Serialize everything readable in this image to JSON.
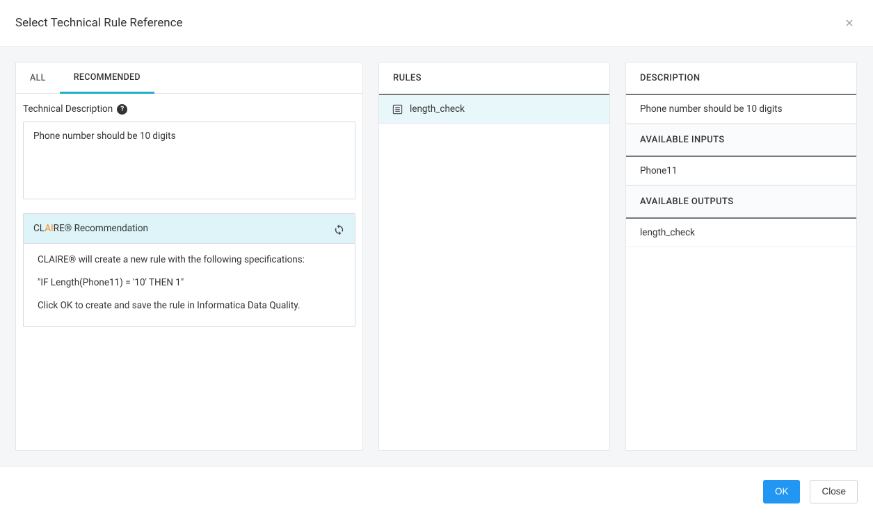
{
  "header": {
    "title": "Select Technical Rule Reference"
  },
  "left": {
    "tabs": {
      "all": "ALL",
      "recommended": "RECOMMENDED"
    },
    "tech_desc_label": "Technical Description",
    "tech_desc_value": "Phone number should be 10 digits",
    "claire": {
      "title_pre": "CL",
      "title_ai": "AI",
      "title_post": "RE® Recommendation",
      "line1": "CLAIRE® will create a new rule with the following specifications:",
      "line2": "\"IF Length(Phone11) = '10' THEN 1\"",
      "line3": "Click OK to create and save the rule in Informatica Data Quality."
    }
  },
  "middle": {
    "header": "RULES",
    "selected_rule": "length_check"
  },
  "right": {
    "description_header": "DESCRIPTION",
    "description_value": "Phone number should be 10 digits",
    "inputs_header": "AVAILABLE INPUTS",
    "inputs_value": "Phone11",
    "outputs_header": "AVAILABLE OUTPUTS",
    "outputs_value": "length_check"
  },
  "footer": {
    "ok": "OK",
    "close": "Close"
  }
}
